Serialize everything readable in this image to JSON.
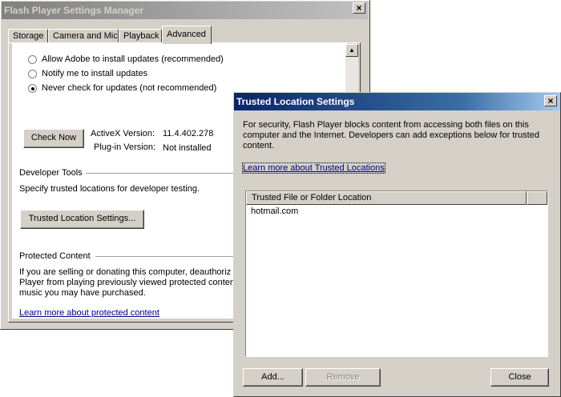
{
  "main_window": {
    "title": "Flash Player Settings Manager",
    "close_glyph": "×",
    "tabs": [
      {
        "label": "Storage"
      },
      {
        "label": "Camera and Mic"
      },
      {
        "label": "Playback"
      },
      {
        "label": "Advanced"
      }
    ],
    "active_tab": "Advanced",
    "update_options": [
      {
        "label": "Allow Adobe to install updates (recommended)",
        "selected": false
      },
      {
        "label": "Notify me to install updates",
        "selected": false
      },
      {
        "label": "Never check for updates (not recommended)",
        "selected": true
      }
    ],
    "check_now_label": "Check Now",
    "activex_label": "ActiveX Version:",
    "activex_value": "11.4.402.278",
    "plugin_label": "Plug-in Version:",
    "plugin_value": "Not installed",
    "developer_tools": {
      "heading": "Developer Tools",
      "description": "Specify trusted locations for developer testing.",
      "button_label": "Trusted Location Settings..."
    },
    "protected_content": {
      "heading": "Protected Content",
      "line1": "If you are selling or donating this computer, deauthoriz",
      "line2": "Player from playing previously viewed protected conten",
      "line3": "music you may have purchased.",
      "link": "Learn more about protected content"
    }
  },
  "dialog": {
    "title": "Trusted Location Settings",
    "close_glyph": "×",
    "description_line1": "For security, Flash Player blocks content from accessing both files on this",
    "description_line2": "computer and the Internet. Developers can add exceptions below for trusted",
    "description_line3": "content.",
    "learn_more_link": "Learn more about Trusted Locations",
    "list_header": "Trusted File or Folder Location",
    "list_items": [
      "hotmail.com"
    ],
    "add_label": "Add...",
    "remove_label": "Remove",
    "close_label": "Close"
  },
  "colors": {
    "window_face": "#d4d0c8",
    "active_title": "#0a246a",
    "inactive_title": "#808080",
    "link": "#000080"
  }
}
